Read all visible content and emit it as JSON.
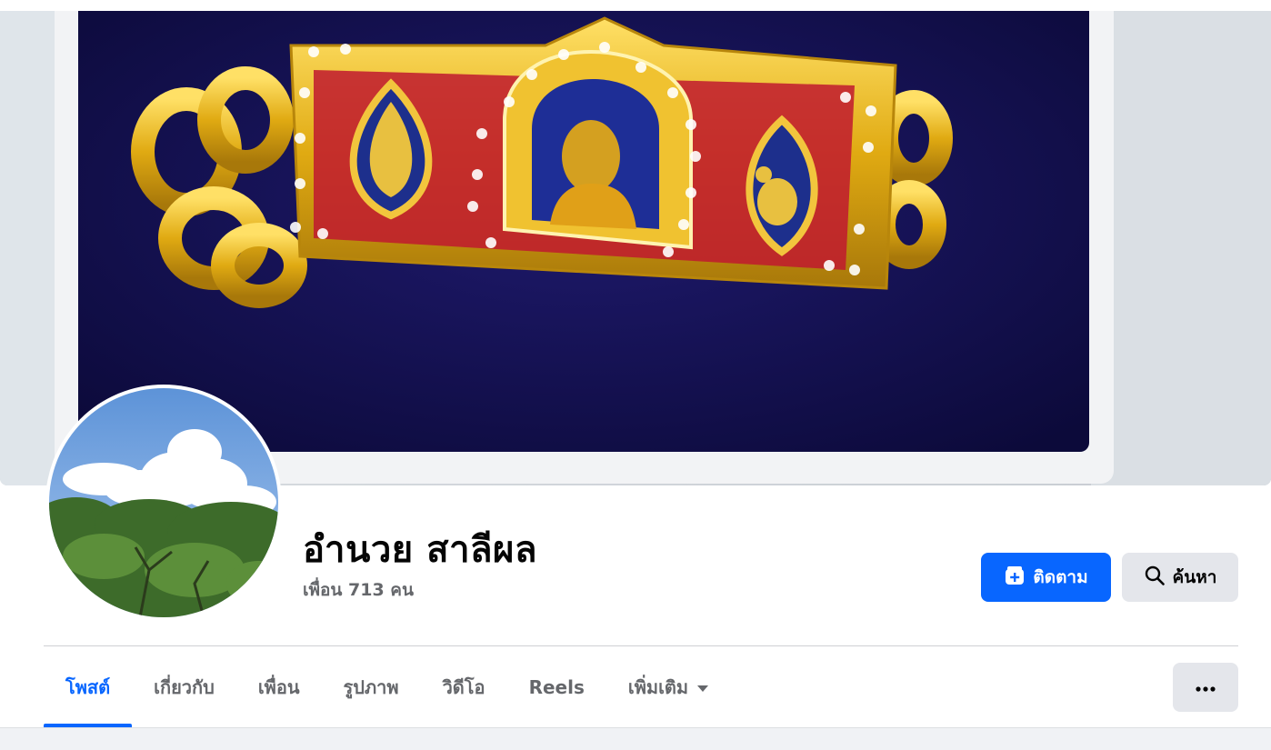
{
  "profile": {
    "name": "อำนวย สาลีผล",
    "friends_text": "เพื่อน 713 คน"
  },
  "actions": {
    "follow_label": "ติดตาม",
    "search_label": "ค้นหา",
    "more_label": "···"
  },
  "tabs": [
    {
      "label": "โพสต์",
      "active": true
    },
    {
      "label": "เกี่ยวกับ",
      "active": false
    },
    {
      "label": "เพื่อน",
      "active": false
    },
    {
      "label": "รูปภาพ",
      "active": false
    },
    {
      "label": "วิดีโอ",
      "active": false
    },
    {
      "label": "Reels",
      "active": false
    },
    {
      "label": "เพิ่มเติม",
      "active": false,
      "dropdown": true
    }
  ],
  "colors": {
    "accent": "#0866ff",
    "secondary_button": "#e4e6eb",
    "muted_text": "#65676b"
  },
  "icons": {
    "follow": "follow-plus-icon",
    "search": "search-icon",
    "dropdown": "caret-down-icon",
    "more": "more-horizontal-icon"
  }
}
